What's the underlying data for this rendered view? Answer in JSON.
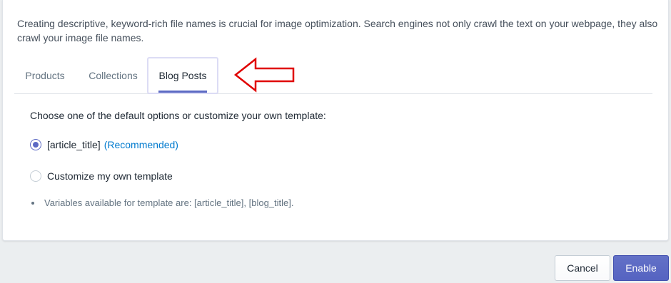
{
  "description": "Creating descriptive, keyword-rich file names is crucial for image optimization. Search engines not only crawl the text on your webpage, they also crawl your image file names.",
  "tabs": [
    {
      "label": "Products",
      "selected": false
    },
    {
      "label": "Collections",
      "selected": false
    },
    {
      "label": "Blog Posts",
      "selected": true
    }
  ],
  "template": {
    "prompt": "Choose one of the default options or customize your own template:",
    "options": [
      {
        "label": "[article_title]",
        "tag": "(Recommended)",
        "checked": true
      },
      {
        "label": "Customize my own template",
        "checked": false
      }
    ],
    "variables_note": "Variables available for template are: [article_title], [blog_title]."
  },
  "footer": {
    "cancel_label": "Cancel",
    "enable_label": "Enable"
  },
  "colors": {
    "accent": "#5c6ac4",
    "link": "#007ace",
    "annotation_arrow": "#e00000"
  }
}
